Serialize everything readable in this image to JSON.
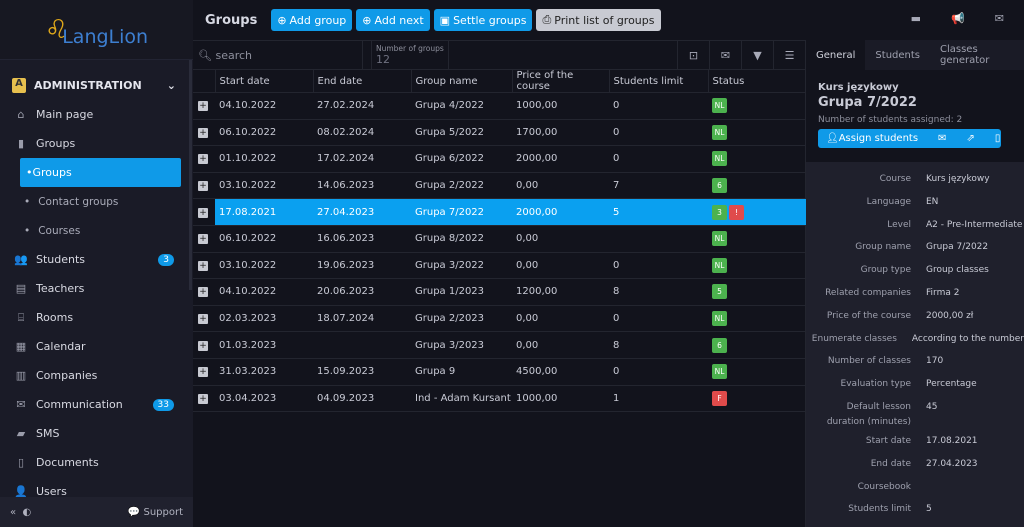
{
  "logo": {
    "text": "LangLion"
  },
  "sidebar": {
    "section": "ADMINISTRATION",
    "items": [
      {
        "label": "Main page",
        "icon": "home-icon",
        "glyph": "⌂",
        "type": "item"
      },
      {
        "label": "Groups",
        "icon": "book-icon",
        "glyph": "▮",
        "type": "item",
        "bold": true
      },
      {
        "label": "Groups",
        "type": "active"
      },
      {
        "label": "Contact groups",
        "type": "sub"
      },
      {
        "label": "Courses",
        "type": "sub"
      },
      {
        "label": "Students",
        "icon": "students-icon",
        "glyph": "👥",
        "type": "item",
        "badge": "3"
      },
      {
        "label": "Teachers",
        "icon": "teachers-icon",
        "glyph": "▤",
        "type": "item"
      },
      {
        "label": "Rooms",
        "icon": "rooms-icon",
        "glyph": "⌸",
        "type": "item"
      },
      {
        "label": "Calendar",
        "icon": "calendar-icon",
        "glyph": "▦",
        "type": "item"
      },
      {
        "label": "Companies",
        "icon": "companies-icon",
        "glyph": "▥",
        "type": "item"
      },
      {
        "label": "Communication",
        "icon": "envelope-icon",
        "glyph": "✉",
        "type": "item",
        "badge": "33"
      },
      {
        "label": "SMS",
        "icon": "sms-icon",
        "glyph": "▰",
        "type": "item"
      },
      {
        "label": "Documents",
        "icon": "document-icon",
        "glyph": "▯",
        "type": "item"
      },
      {
        "label": "Users",
        "icon": "users-icon",
        "glyph": "👤",
        "type": "item"
      }
    ],
    "support": "Support"
  },
  "topbar": {
    "title": "Groups",
    "add_group": "Add group",
    "add_next": "Add next",
    "settle": "Settle groups",
    "print": "Print list of groups"
  },
  "filter": {
    "search_placeholder": "search",
    "count_label": "Number of groups",
    "count_value": "12"
  },
  "table": {
    "columns": [
      "Start date",
      "End date",
      "Group name",
      "Price of the course",
      "Students limit",
      "Status"
    ],
    "rows": [
      {
        "start": "04.10.2022",
        "end": "27.02.2024",
        "name": "Grupa 4/2022",
        "price": "1000,00",
        "limit": "0",
        "status": [
          {
            "t": "NL",
            "c": "g"
          }
        ]
      },
      {
        "start": "06.10.2022",
        "end": "08.02.2024",
        "name": "Grupa 5/2022",
        "price": "1700,00",
        "limit": "0",
        "status": [
          {
            "t": "NL",
            "c": "g"
          }
        ]
      },
      {
        "start": "01.10.2022",
        "end": "17.02.2024",
        "name": "Grupa 6/2022",
        "price": "2000,00",
        "limit": "0",
        "status": [
          {
            "t": "NL",
            "c": "g"
          }
        ]
      },
      {
        "start": "03.10.2022",
        "end": "14.06.2023",
        "name": "Grupa 2/2022",
        "price": "0,00",
        "limit": "7",
        "status": [
          {
            "t": "6",
            "c": "g"
          }
        ]
      },
      {
        "start": "17.08.2021",
        "end": "27.04.2023",
        "name": "Grupa 7/2022",
        "price": "2000,00",
        "limit": "5",
        "status": [
          {
            "t": "3",
            "c": "g"
          },
          {
            "t": "!",
            "c": "r"
          }
        ],
        "selected": true
      },
      {
        "start": "06.10.2022",
        "end": "16.06.2023",
        "name": "Grupa 8/2022",
        "price": "0,00",
        "limit": "",
        "status": [
          {
            "t": "NL",
            "c": "g"
          }
        ]
      },
      {
        "start": "03.10.2022",
        "end": "19.06.2023",
        "name": "Grupa 3/2022",
        "price": "0,00",
        "limit": "0",
        "status": [
          {
            "t": "NL",
            "c": "g"
          }
        ]
      },
      {
        "start": "04.10.2022",
        "end": "20.06.2023",
        "name": "Grupa 1/2023",
        "price": "1200,00",
        "limit": "8",
        "status": [
          {
            "t": "5",
            "c": "g"
          }
        ]
      },
      {
        "start": "02.03.2023",
        "end": "18.07.2024",
        "name": "Grupa 2/2023",
        "price": "0,00",
        "limit": "0",
        "status": [
          {
            "t": "NL",
            "c": "g"
          }
        ]
      },
      {
        "start": "01.03.2023",
        "end": "",
        "name": "Grupa 3/2023",
        "price": "0,00",
        "limit": "8",
        "status": [
          {
            "t": "6",
            "c": "g"
          }
        ]
      },
      {
        "start": "31.03.2023",
        "end": "15.09.2023",
        "name": "Grupa 9",
        "price": "4500,00",
        "limit": "0",
        "status": [
          {
            "t": "NL",
            "c": "g"
          }
        ]
      },
      {
        "start": "03.04.2023",
        "end": "04.09.2023",
        "name": "Ind - Adam Kursant",
        "price": "1000,00",
        "limit": "1",
        "status": [
          {
            "t": "F",
            "c": "r"
          }
        ]
      }
    ]
  },
  "panel": {
    "tabs": [
      "General",
      "Students",
      "Classes generator"
    ],
    "course": "Kurs językowy",
    "group": "Grupa 7/2022",
    "assigned": "Number of students assigned: 2",
    "assign_btn": "Assign students",
    "details": [
      {
        "k": "Course",
        "v": "Kurs językowy"
      },
      {
        "k": "Language",
        "v": "EN"
      },
      {
        "k": "Level",
        "v": "A2 - Pre-Intermediate"
      },
      {
        "k": "Group name",
        "v": "Grupa 7/2022"
      },
      {
        "k": "Group type",
        "v": "Group classes"
      },
      {
        "k": "Related companies",
        "v": "Firma 2"
      },
      {
        "k": "Price of the course",
        "v": "2000,00 zł"
      },
      {
        "k": "Enumerate classes",
        "v": "According to the number"
      },
      {
        "k": "Number of classes",
        "v": "170"
      },
      {
        "k": "Evaluation type",
        "v": "Percentage"
      },
      {
        "k": "Default lesson duration (minutes)",
        "v": "45",
        "tall": true
      },
      {
        "k": "Start date",
        "v": "17.08.2021"
      },
      {
        "k": "End date",
        "v": "27.04.2023"
      },
      {
        "k": "Coursebook",
        "v": ""
      },
      {
        "k": "Students limit",
        "v": "5"
      }
    ]
  },
  "colors": {
    "accent": "#0f9ae8",
    "status_green": "#4cb24e",
    "status_red": "#e04b4b"
  }
}
